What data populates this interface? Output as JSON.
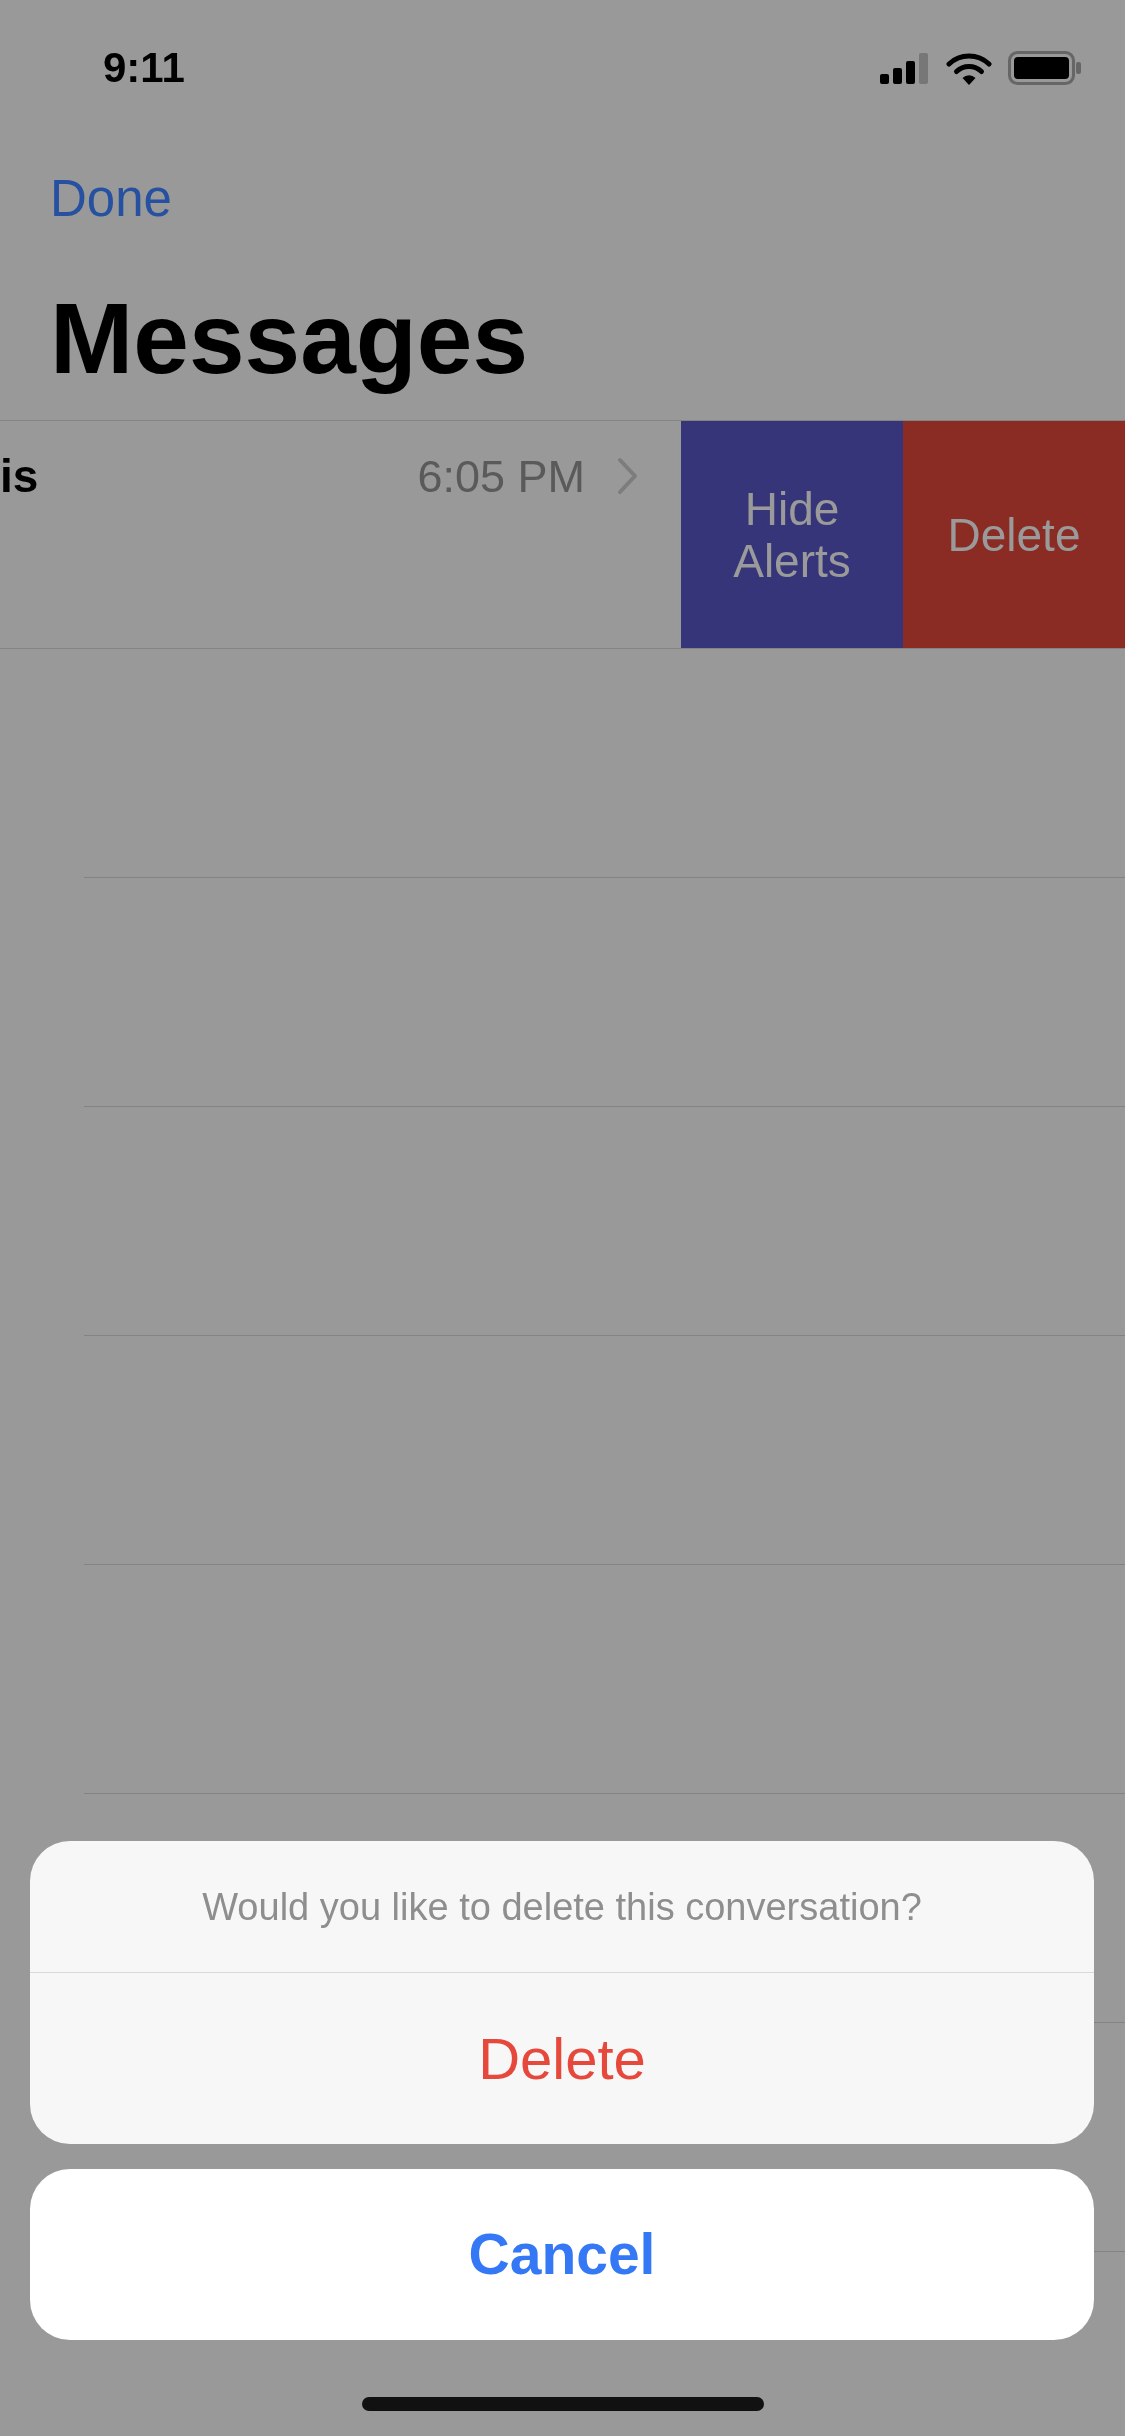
{
  "status_bar": {
    "time": "9:11"
  },
  "nav": {
    "left_button": "Done",
    "title": "Messages"
  },
  "conversations": [
    {
      "name": "is",
      "time": "6:05 PM",
      "swiped": true,
      "actions": [
        {
          "kind": "hide_alerts",
          "label": "Hide Alerts"
        },
        {
          "kind": "delete",
          "label": "Delete"
        }
      ]
    }
  ],
  "action_sheet": {
    "message": "Would you like to delete this conversation?",
    "actions": [
      {
        "kind": "destructive",
        "label": "Delete"
      }
    ],
    "cancel": "Cancel"
  }
}
